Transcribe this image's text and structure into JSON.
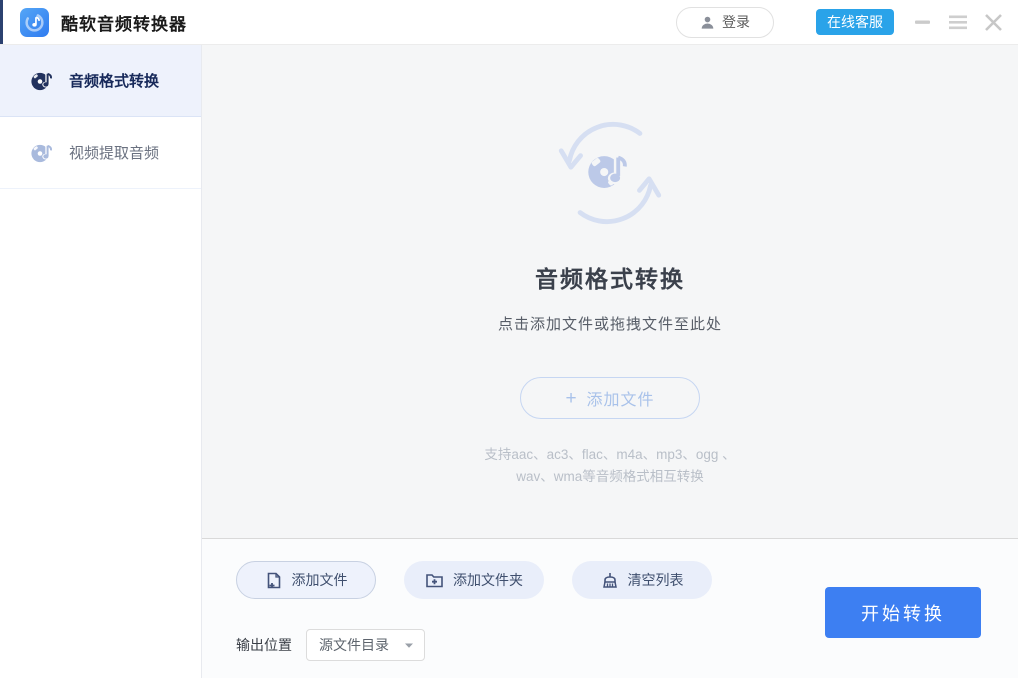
{
  "window": {
    "title": "酷软音频转换器",
    "login_label": "登录",
    "support_label": "在线客服"
  },
  "sidebar": {
    "items": [
      {
        "label": "音频格式转换",
        "active": true
      },
      {
        "label": "视频提取音频",
        "active": false
      }
    ]
  },
  "dropzone": {
    "title": "音频格式转换",
    "subtitle": "点击添加文件或拖拽文件至此处",
    "add_plus": "+",
    "add_label": "添加文件",
    "formats_line1": "支持aac、ac3、flac、m4a、mp3、ogg 、",
    "formats_line2": "wav、wma等音频格式相互转换"
  },
  "toolbar": {
    "add_file": "添加文件",
    "add_folder": "添加文件夹",
    "clear_list": "清空列表",
    "start_button": "开始转换"
  },
  "output": {
    "label": "输出位置",
    "value": "源文件目录"
  },
  "icons": {
    "logo": "disc-music-note",
    "login": "user",
    "window": [
      "minimize",
      "menu",
      "close"
    ],
    "sidebar": "disc-music-note",
    "center": "disc-note-refresh-arrows",
    "buttons": [
      "file-plus",
      "folder-plus",
      "broom"
    ],
    "dropdown": "caret-down"
  },
  "colors": {
    "primary_blue": "#3d7ff2",
    "support_badge": "#2aa3e9",
    "active_item_bg": "#eef2fc",
    "dropzone_bg": "#f5f6f7",
    "accent_strip": "#2b4170"
  }
}
